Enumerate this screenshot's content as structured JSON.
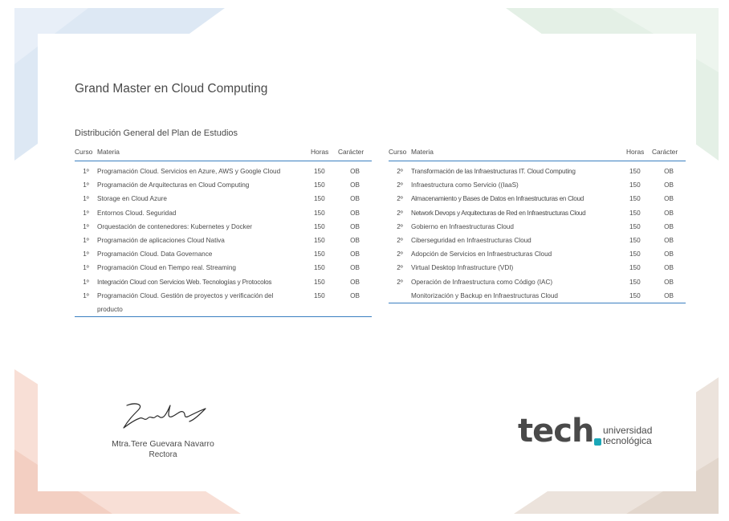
{
  "document": {
    "title": "Grand Master en Cloud Computing",
    "subtitle": "Distribución General del Plan de Estudios"
  },
  "table_headers": {
    "curso": "Curso",
    "materia": "Materia",
    "horas": "Horas",
    "caracter": "Carácter"
  },
  "left_table": [
    {
      "curso": "1º",
      "materia": "Programación Cloud. Servicios en Azure, AWS y Google Cloud",
      "horas": "150",
      "caracter": "OB"
    },
    {
      "curso": "1º",
      "materia": "Programación de Arquitecturas en Cloud Computing",
      "horas": "150",
      "caracter": "OB"
    },
    {
      "curso": "1º",
      "materia": "Storage en Cloud Azure",
      "horas": "150",
      "caracter": "OB"
    },
    {
      "curso": "1º",
      "materia": "Entornos Cloud. Seguridad",
      "horas": "150",
      "caracter": "OB"
    },
    {
      "curso": "1º",
      "materia": "Orquestación de contenedores: Kubernetes y Docker",
      "horas": "150",
      "caracter": "OB"
    },
    {
      "curso": "1º",
      "materia": "Programación de aplicaciones Cloud Nativa",
      "horas": "150",
      "caracter": "OB"
    },
    {
      "curso": "1º",
      "materia": "Programación Cloud. Data Governance",
      "horas": "150",
      "caracter": "OB"
    },
    {
      "curso": "1º",
      "materia": "Programación Cloud en Tiempo real. Streaming",
      "horas": "150",
      "caracter": "OB"
    },
    {
      "curso": "1º",
      "materia": "Integración Cloud con Servicios Web. Tecnologías y Protocolos",
      "horas": "150",
      "caracter": "OB"
    },
    {
      "curso": "1º",
      "materia": "Programación Cloud. Gestión de proyectos y verificación del producto",
      "horas": "150",
      "caracter": "OB"
    }
  ],
  "right_table": [
    {
      "curso": "2º",
      "materia": "Transformación de las Infraestructuras IT. Cloud Computing",
      "horas": "150",
      "caracter": "OB"
    },
    {
      "curso": "2º",
      "materia": "Infraestructura como Servicio ((IaaS)",
      "horas": "150",
      "caracter": "OB"
    },
    {
      "curso": "2º",
      "materia": "Almacenamiento y Bases de Datos en Infraestructuras en Cloud",
      "horas": "150",
      "caracter": "OB"
    },
    {
      "curso": "2º",
      "materia": "Network Devops y Arquitecturas de Red en Infraestructuras Cloud",
      "horas": "150",
      "caracter": "OB"
    },
    {
      "curso": "2º",
      "materia": "Gobierno en Infraestructuras Cloud",
      "horas": "150",
      "caracter": "OB"
    },
    {
      "curso": "2º",
      "materia": "Ciberseguridad en Infraestructuras Cloud",
      "horas": "150",
      "caracter": "OB"
    },
    {
      "curso": "2º",
      "materia": "Adopción de Servicios en Infraestructuras Cloud",
      "horas": "150",
      "caracter": "OB"
    },
    {
      "curso": "2º",
      "materia": "Virtual Desktop Infrastructure (VDI)",
      "horas": "150",
      "caracter": "OB"
    },
    {
      "curso": "2º",
      "materia": "Operación de Infraestructura como Código (IAC)",
      "horas": "150",
      "caracter": "OB"
    },
    {
      "curso": "",
      "materia": "Monitorización y Backup en Infraestructuras Cloud",
      "horas": "150",
      "caracter": "OB"
    }
  ],
  "signature": {
    "name": "Mtra.Tere Guevara Navarro",
    "role": "Rectora"
  },
  "logo": {
    "brand": "tech",
    "line1": "universidad",
    "line2": "tecnológica",
    "accent_color": "#1aa7b8"
  },
  "colors": {
    "table_rule": "#3a7fc1",
    "text": "#4a4a4a"
  }
}
